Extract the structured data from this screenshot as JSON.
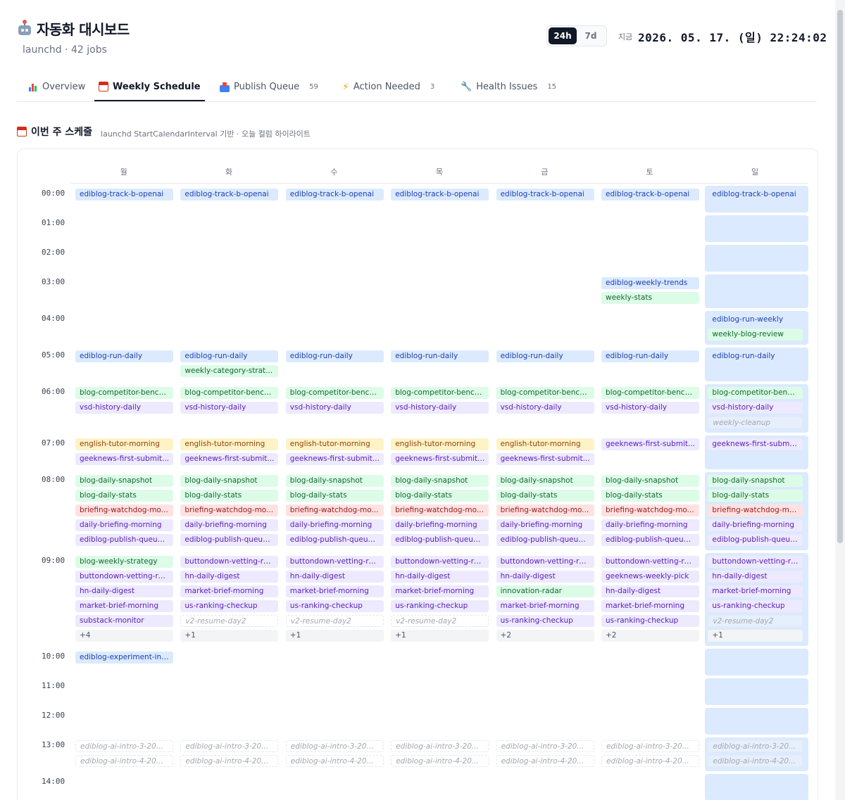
{
  "app": {
    "title": "자동화 대시보드",
    "subtitle": "launchd · 42 jobs"
  },
  "range_toggle": [
    {
      "label": "24h",
      "active": true
    },
    {
      "label": "7d",
      "active": false
    }
  ],
  "now": {
    "label": "지금",
    "value": "2026. 05. 17. (일) 22:24:02"
  },
  "tabs": [
    {
      "label": "Overview",
      "icon": "bar-chart-icon",
      "badge": "",
      "active": false
    },
    {
      "label": "Weekly Schedule",
      "icon": "calendar-icon",
      "badge": "",
      "active": true
    },
    {
      "label": "Publish Queue",
      "icon": "inbox-icon",
      "badge": "59",
      "active": false
    },
    {
      "label": "Action Needed",
      "icon": "lightning-icon",
      "badge": "3",
      "active": false
    },
    {
      "label": "Health Issues",
      "icon": "wrench-icon",
      "badge": "15",
      "active": false
    }
  ],
  "section": {
    "title": "이번 주 스케줄",
    "icon": "calendar-icon",
    "description": "launchd StartCalendarInterval 기반 · 오늘 컬럼 하이라이트"
  },
  "schedule": {
    "days": [
      "월",
      "화",
      "수",
      "목",
      "금",
      "토",
      "일"
    ],
    "today_index": 6,
    "colors": {
      "blue": "#dbeafe",
      "green": "#dcfce7",
      "purple": "#ede9fe",
      "yellow": "#fef3c7",
      "red": "#fee2e2",
      "today": "#dbeafe"
    },
    "hours": [
      {
        "time": "00:00",
        "cells": [
          [
            [
              "ediblog-track-b-openai",
              "blue"
            ]
          ],
          [
            [
              "ediblog-track-b-openai",
              "blue"
            ]
          ],
          [
            [
              "ediblog-track-b-openai",
              "blue"
            ]
          ],
          [
            [
              "ediblog-track-b-openai",
              "blue"
            ]
          ],
          [
            [
              "ediblog-track-b-openai",
              "blue"
            ]
          ],
          [
            [
              "ediblog-track-b-openai",
              "blue"
            ]
          ],
          [
            [
              "ediblog-track-b-openai",
              "blue"
            ]
          ]
        ]
      },
      {
        "time": "01:00",
        "cells": [
          [],
          [],
          [],
          [],
          [],
          [],
          []
        ]
      },
      {
        "time": "02:00",
        "cells": [
          [],
          [],
          [],
          [],
          [],
          [],
          []
        ]
      },
      {
        "time": "03:00",
        "cells": [
          [],
          [],
          [],
          [],
          [],
          [
            [
              "ediblog-weekly-trends",
              "blue"
            ],
            [
              "weekly-stats",
              "green"
            ]
          ],
          []
        ]
      },
      {
        "time": "04:00",
        "cells": [
          [],
          [],
          [],
          [],
          [],
          [],
          [
            [
              "ediblog-run-weekly",
              "blue"
            ],
            [
              "weekly-blog-review",
              "green"
            ]
          ]
        ]
      },
      {
        "time": "05:00",
        "cells": [
          [
            [
              "ediblog-run-daily",
              "blue"
            ]
          ],
          [
            [
              "ediblog-run-daily",
              "blue"
            ],
            [
              "weekly-category-strat...",
              "green"
            ]
          ],
          [
            [
              "ediblog-run-daily",
              "blue"
            ]
          ],
          [
            [
              "ediblog-run-daily",
              "blue"
            ]
          ],
          [
            [
              "ediblog-run-daily",
              "blue"
            ]
          ],
          [
            [
              "ediblog-run-daily",
              "blue"
            ]
          ],
          [
            [
              "ediblog-run-daily",
              "blue"
            ]
          ]
        ]
      },
      {
        "time": "06:00",
        "cells": [
          [
            [
              "blog-competitor-bench...",
              "green"
            ],
            [
              "vsd-history-daily",
              "purple"
            ]
          ],
          [
            [
              "blog-competitor-bench...",
              "green"
            ],
            [
              "vsd-history-daily",
              "purple"
            ]
          ],
          [
            [
              "blog-competitor-bench...",
              "green"
            ],
            [
              "vsd-history-daily",
              "purple"
            ]
          ],
          [
            [
              "blog-competitor-bench...",
              "green"
            ],
            [
              "vsd-history-daily",
              "purple"
            ]
          ],
          [
            [
              "blog-competitor-bench...",
              "green"
            ],
            [
              "vsd-history-daily",
              "purple"
            ]
          ],
          [
            [
              "blog-competitor-bench...",
              "green"
            ],
            [
              "vsd-history-daily",
              "purple"
            ]
          ],
          [
            [
              "blog-competitor-bench...",
              "green"
            ],
            [
              "vsd-history-daily",
              "purple"
            ],
            [
              "weekly-cleanup",
              "ghost"
            ]
          ]
        ]
      },
      {
        "time": "07:00",
        "cells": [
          [
            [
              "english-tutor-morning",
              "yellow"
            ],
            [
              "geeknews-first-submit...",
              "purple"
            ]
          ],
          [
            [
              "english-tutor-morning",
              "yellow"
            ],
            [
              "geeknews-first-submit...",
              "purple"
            ]
          ],
          [
            [
              "english-tutor-morning",
              "yellow"
            ],
            [
              "geeknews-first-submit...",
              "purple"
            ]
          ],
          [
            [
              "english-tutor-morning",
              "yellow"
            ],
            [
              "geeknews-first-submit...",
              "purple"
            ]
          ],
          [
            [
              "english-tutor-morning",
              "yellow"
            ],
            [
              "geeknews-first-submit...",
              "purple"
            ]
          ],
          [
            [
              "geeknews-first-submit...",
              "purple"
            ]
          ],
          [
            [
              "geeknews-first-submit...",
              "purple"
            ]
          ]
        ]
      },
      {
        "time": "08:00",
        "cells": [
          [
            [
              "blog-daily-snapshot",
              "green"
            ],
            [
              "blog-daily-stats",
              "green"
            ],
            [
              "briefing-watchdog-mo...",
              "red"
            ],
            [
              "daily-briefing-morning",
              "purple"
            ],
            [
              "ediblog-publish-queue...",
              "purple"
            ]
          ],
          [
            [
              "blog-daily-snapshot",
              "green"
            ],
            [
              "blog-daily-stats",
              "green"
            ],
            [
              "briefing-watchdog-mo...",
              "red"
            ],
            [
              "daily-briefing-morning",
              "purple"
            ],
            [
              "ediblog-publish-queue...",
              "purple"
            ]
          ],
          [
            [
              "blog-daily-snapshot",
              "green"
            ],
            [
              "blog-daily-stats",
              "green"
            ],
            [
              "briefing-watchdog-mo...",
              "red"
            ],
            [
              "daily-briefing-morning",
              "purple"
            ],
            [
              "ediblog-publish-queue...",
              "purple"
            ]
          ],
          [
            [
              "blog-daily-snapshot",
              "green"
            ],
            [
              "blog-daily-stats",
              "green"
            ],
            [
              "briefing-watchdog-mo...",
              "red"
            ],
            [
              "daily-briefing-morning",
              "purple"
            ],
            [
              "ediblog-publish-queue...",
              "purple"
            ]
          ],
          [
            [
              "blog-daily-snapshot",
              "green"
            ],
            [
              "blog-daily-stats",
              "green"
            ],
            [
              "briefing-watchdog-mo...",
              "red"
            ],
            [
              "daily-briefing-morning",
              "purple"
            ],
            [
              "ediblog-publish-queue...",
              "purple"
            ]
          ],
          [
            [
              "blog-daily-snapshot",
              "green"
            ],
            [
              "blog-daily-stats",
              "green"
            ],
            [
              "briefing-watchdog-mo...",
              "red"
            ],
            [
              "daily-briefing-morning",
              "purple"
            ],
            [
              "ediblog-publish-queue...",
              "purple"
            ]
          ],
          [
            [
              "blog-daily-snapshot",
              "green"
            ],
            [
              "blog-daily-stats",
              "green"
            ],
            [
              "briefing-watchdog-mo...",
              "red"
            ],
            [
              "daily-briefing-morning",
              "purple"
            ],
            [
              "ediblog-publish-queue...",
              "purple"
            ]
          ]
        ]
      },
      {
        "time": "09:00",
        "cells": [
          [
            [
              "blog-weekly-strategy",
              "green"
            ],
            [
              "buttondown-vetting-re...",
              "purple"
            ],
            [
              "hn-daily-digest",
              "purple"
            ],
            [
              "market-brief-morning",
              "purple"
            ],
            [
              "substack-monitor",
              "purple"
            ],
            [
              "+4",
              "more"
            ]
          ],
          [
            [
              "buttondown-vetting-re...",
              "purple"
            ],
            [
              "hn-daily-digest",
              "purple"
            ],
            [
              "market-brief-morning",
              "purple"
            ],
            [
              "us-ranking-checkup",
              "purple"
            ],
            [
              "v2-resume-day2",
              "ghost"
            ],
            [
              "+1",
              "more"
            ]
          ],
          [
            [
              "buttondown-vetting-re...",
              "purple"
            ],
            [
              "hn-daily-digest",
              "purple"
            ],
            [
              "market-brief-morning",
              "purple"
            ],
            [
              "us-ranking-checkup",
              "purple"
            ],
            [
              "v2-resume-day2",
              "ghost"
            ],
            [
              "+1",
              "more"
            ]
          ],
          [
            [
              "buttondown-vetting-re...",
              "purple"
            ],
            [
              "hn-daily-digest",
              "purple"
            ],
            [
              "market-brief-morning",
              "purple"
            ],
            [
              "us-ranking-checkup",
              "purple"
            ],
            [
              "v2-resume-day2",
              "ghost"
            ],
            [
              "+1",
              "more"
            ]
          ],
          [
            [
              "buttondown-vetting-re...",
              "purple"
            ],
            [
              "hn-daily-digest",
              "purple"
            ],
            [
              "innovation-radar",
              "green"
            ],
            [
              "market-brief-morning",
              "purple"
            ],
            [
              "us-ranking-checkup",
              "purple"
            ],
            [
              "+2",
              "more"
            ]
          ],
          [
            [
              "buttondown-vetting-re...",
              "purple"
            ],
            [
              "geeknews-weekly-pick",
              "purple"
            ],
            [
              "hn-daily-digest",
              "purple"
            ],
            [
              "market-brief-morning",
              "purple"
            ],
            [
              "us-ranking-checkup",
              "purple"
            ],
            [
              "+2",
              "more"
            ]
          ],
          [
            [
              "buttondown-vetting-re...",
              "purple"
            ],
            [
              "hn-daily-digest",
              "purple"
            ],
            [
              "market-brief-morning",
              "purple"
            ],
            [
              "us-ranking-checkup",
              "purple"
            ],
            [
              "v2-resume-day2",
              "ghost"
            ],
            [
              "+1",
              "more"
            ]
          ]
        ]
      },
      {
        "time": "10:00",
        "cells": [
          [
            [
              "ediblog-experiment-int...",
              "blue"
            ]
          ],
          [],
          [],
          [],
          [],
          [],
          []
        ]
      },
      {
        "time": "11:00",
        "cells": [
          [],
          [],
          [],
          [],
          [],
          [],
          []
        ]
      },
      {
        "time": "12:00",
        "cells": [
          [],
          [],
          [],
          [],
          [],
          [],
          []
        ]
      },
      {
        "time": "13:00",
        "cells": [
          [
            [
              "ediblog-ai-intro-3-20...",
              "ghost"
            ],
            [
              "ediblog-ai-intro-4-20...",
              "ghost"
            ]
          ],
          [
            [
              "ediblog-ai-intro-3-20...",
              "ghost"
            ],
            [
              "ediblog-ai-intro-4-20...",
              "ghost"
            ]
          ],
          [
            [
              "ediblog-ai-intro-3-20...",
              "ghost"
            ],
            [
              "ediblog-ai-intro-4-20...",
              "ghost"
            ]
          ],
          [
            [
              "ediblog-ai-intro-3-20...",
              "ghost"
            ],
            [
              "ediblog-ai-intro-4-20...",
              "ghost"
            ]
          ],
          [
            [
              "ediblog-ai-intro-3-20...",
              "ghost"
            ],
            [
              "ediblog-ai-intro-4-20...",
              "ghost"
            ]
          ],
          [
            [
              "ediblog-ai-intro-3-20...",
              "ghost"
            ],
            [
              "ediblog-ai-intro-4-20...",
              "ghost"
            ]
          ],
          [
            [
              "ediblog-ai-intro-3-20...",
              "ghost"
            ],
            [
              "ediblog-ai-intro-4-20...",
              "ghost"
            ]
          ]
        ]
      },
      {
        "time": "14:00",
        "cells": [
          [],
          [],
          [],
          [],
          [],
          [],
          []
        ]
      }
    ]
  }
}
